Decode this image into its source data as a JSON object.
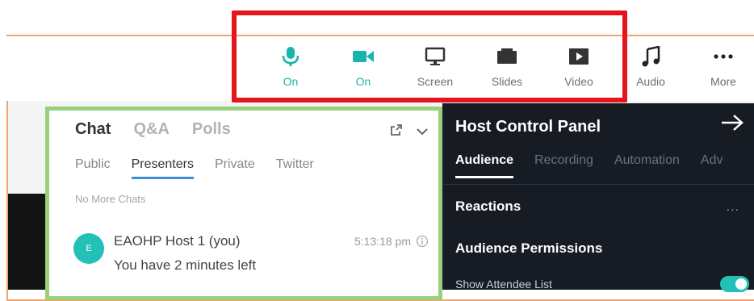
{
  "toolbar": {
    "buttons": [
      {
        "label": "On",
        "icon": "microphone-icon",
        "active": true
      },
      {
        "label": "On",
        "icon": "camera-icon",
        "active": true
      },
      {
        "label": "Screen",
        "icon": "monitor-icon",
        "active": false
      },
      {
        "label": "Slides",
        "icon": "slides-icon",
        "active": false
      },
      {
        "label": "Video",
        "icon": "play-video-icon",
        "active": false
      },
      {
        "label": "Audio",
        "icon": "music-note-icon",
        "active": false
      },
      {
        "label": "More",
        "icon": "more-dots-icon",
        "active": false
      }
    ]
  },
  "chat": {
    "tabs": [
      "Chat",
      "Q&A",
      "Polls"
    ],
    "subtabs": [
      "Public",
      "Presenters",
      "Private",
      "Twitter"
    ],
    "no_more": "No More Chats",
    "message": {
      "avatar": "E",
      "sender": "EAOHP Host 1 (you)",
      "time": "5:13:18 pm",
      "text": "You have 2 minutes left"
    }
  },
  "host": {
    "title": "Host Control Panel",
    "tabs": [
      "Audience",
      "Recording",
      "Automation",
      "Adv"
    ],
    "reactions": "Reactions",
    "more": "...",
    "permissions": "Audience Permissions",
    "show_attendee": "Show Attendee List"
  },
  "colors": {
    "accent": "#19b5ad",
    "highlight": "#e6141b",
    "chat_border": "#9bd07b",
    "frame": "#f3a46b",
    "host_bg": "#161b24"
  }
}
